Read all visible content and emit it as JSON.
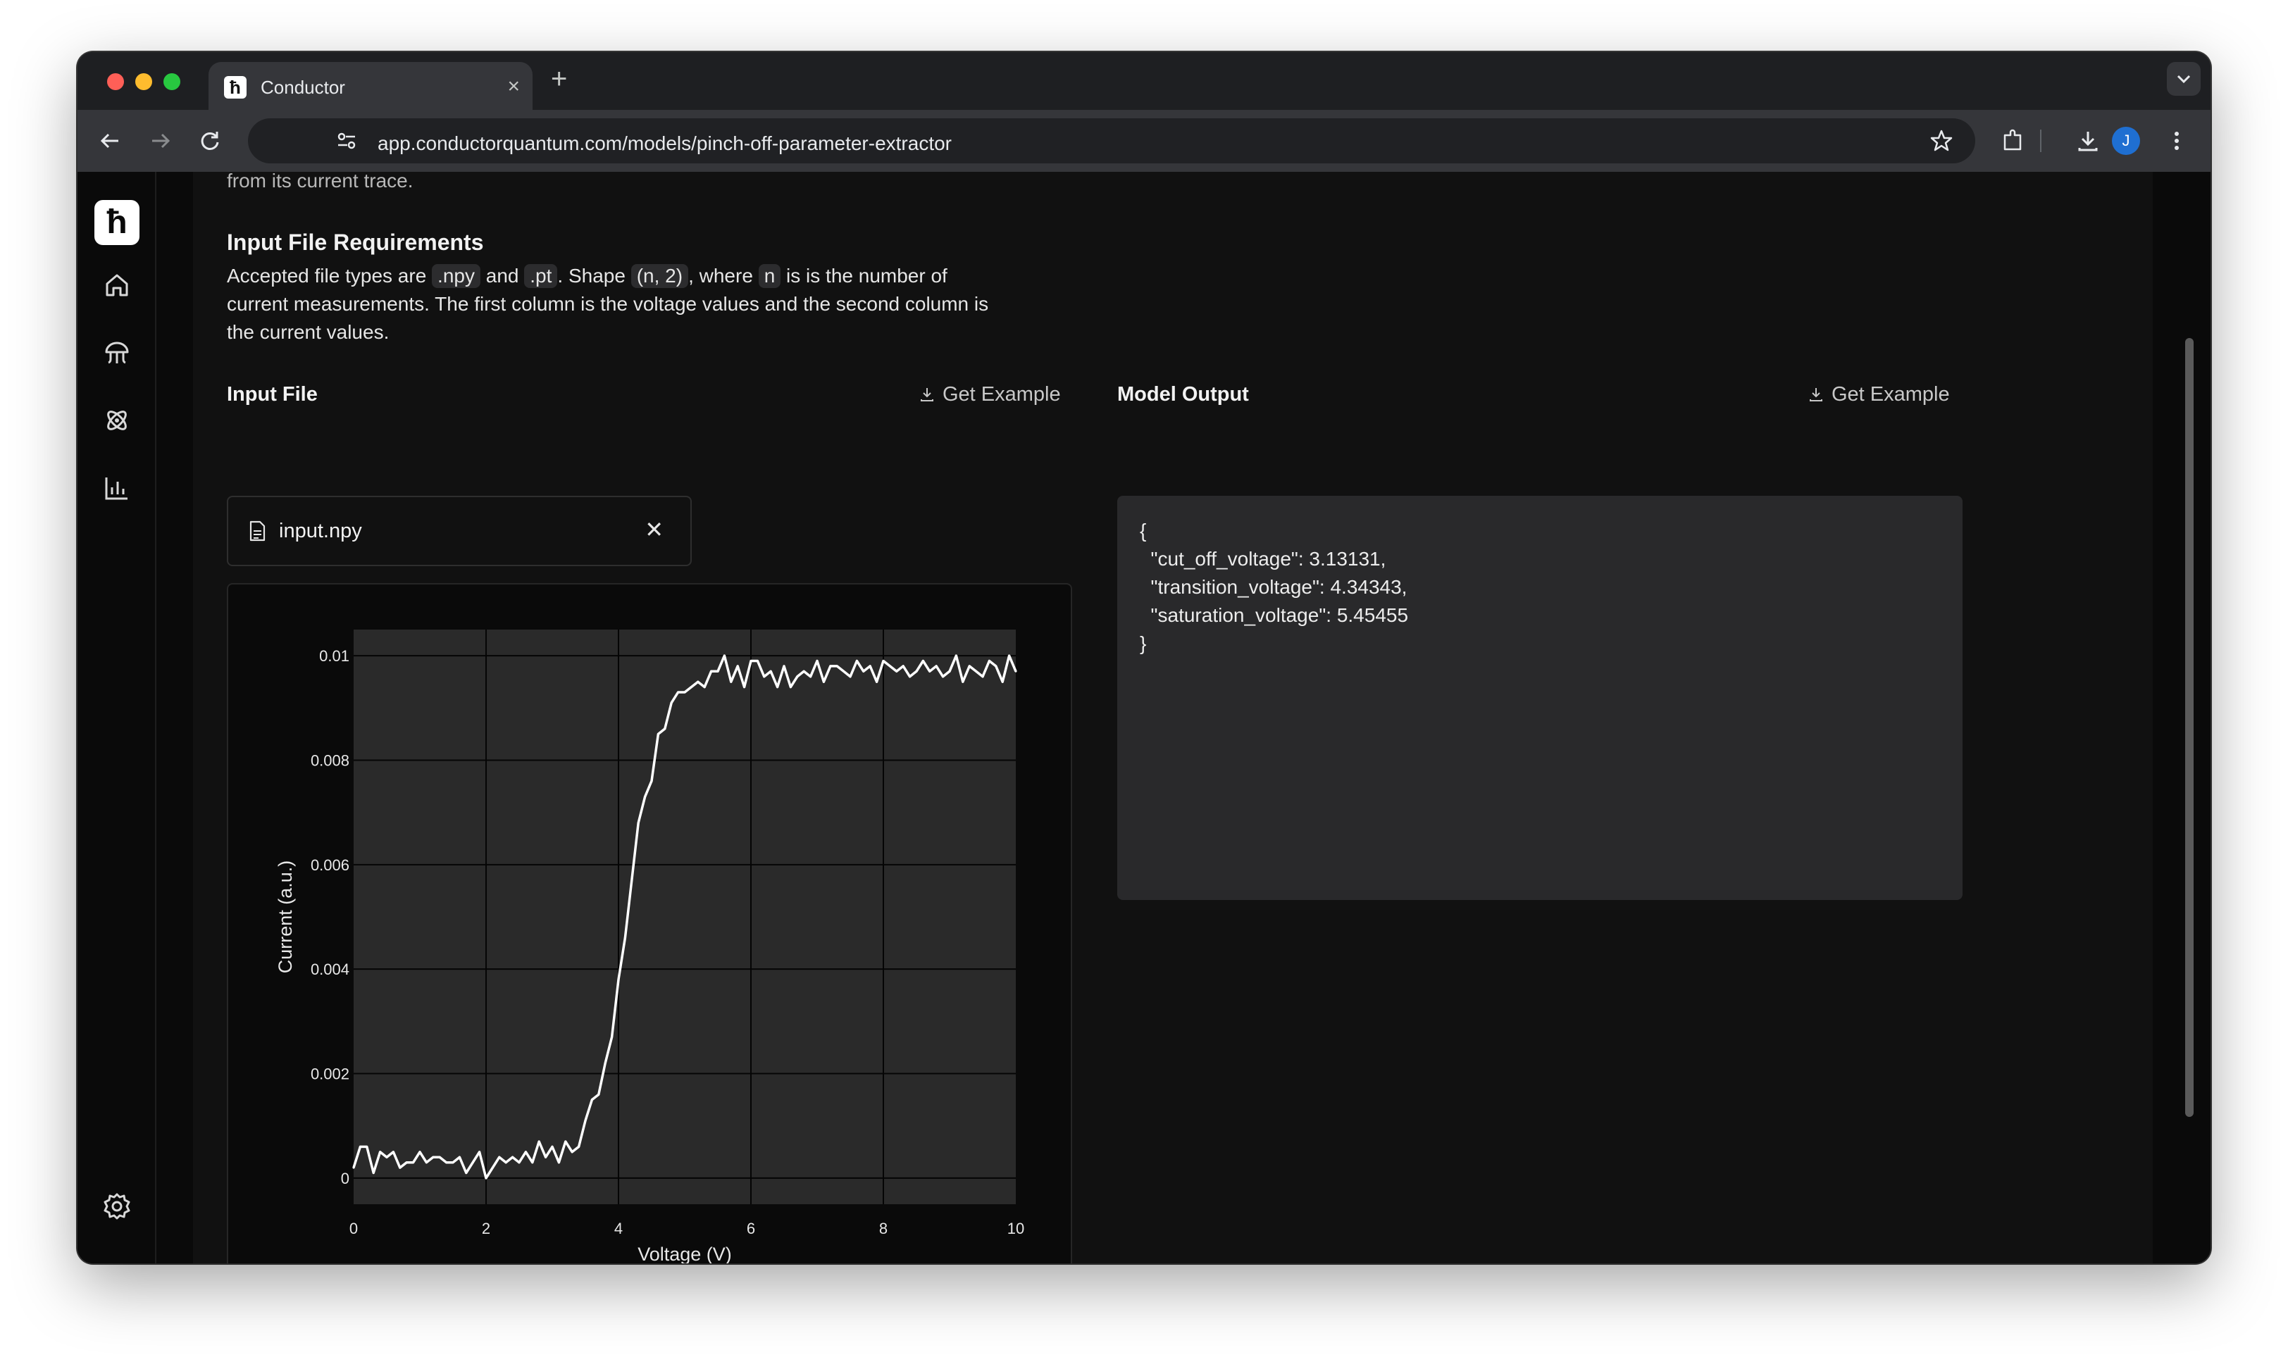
{
  "browser": {
    "tab_title": "Conductor",
    "tab_favicon": "conductor-logo",
    "new_tab": "+",
    "url": "app.conductorquantum.com/models/pinch-off-parameter-extractor",
    "avatar_initial": "J"
  },
  "sidebar": {
    "logo": "conductor-logo",
    "items": [
      "home-icon",
      "jellyfish-icon",
      "atom-icon",
      "bar-chart-icon"
    ],
    "settings": "gear-icon"
  },
  "content": {
    "cut_text": "from its current trace.",
    "req_heading": "Input File Requirements",
    "req": {
      "t1": "Accepted file types are ",
      "c1": ".npy",
      "t2": " and ",
      "c2": ".pt",
      "t3": ". Shape ",
      "c3": "(n, 2)",
      "t4": ", where ",
      "c4": "n",
      "t5": " is is the number of current measurements. The first column is the voltage values and the second column is the current values."
    },
    "input_label": "Input File",
    "get_example": "Get Example",
    "file_name": "input.npy",
    "file_remove": "✕",
    "output_label": "Model Output",
    "output_text": "{\n  \"cut_off_voltage\": 3.13131,\n  \"transition_voltage\": 4.34343,\n  \"saturation_voltage\": 5.45455\n}"
  },
  "colors": {
    "page_bg": "#111111",
    "panel_bg": "#29292b",
    "plot_bg": "#2a2a2a",
    "trace": "#ffffff"
  },
  "chart_data": {
    "type": "line",
    "xlabel": "Voltage (V)",
    "ylabel": "Current (a.u.)",
    "xlim": [
      0,
      10
    ],
    "ylim": [
      -0.0005,
      0.0105
    ],
    "x_ticks": [
      0,
      2,
      4,
      6,
      8,
      10
    ],
    "x_tick_labels": [
      "0",
      "2",
      "4",
      "6",
      "8",
      "10"
    ],
    "y_ticks": [
      0,
      0.002,
      0.004,
      0.006,
      0.008,
      0.01
    ],
    "y_tick_labels": [
      "0",
      "0.002",
      "0.004",
      "0.006",
      "0.008",
      "0.01"
    ],
    "grid": true,
    "series": [
      {
        "x": [
          0,
          0.1,
          0.2,
          0.3,
          0.4,
          0.5,
          0.6,
          0.7,
          0.8,
          0.9,
          1.0,
          1.1,
          1.2,
          1.3,
          1.4,
          1.5,
          1.6,
          1.7,
          1.8,
          1.9,
          2.0,
          2.1,
          2.2,
          2.3,
          2.4,
          2.5,
          2.6,
          2.7,
          2.8,
          2.9,
          3.0,
          3.1,
          3.2,
          3.3,
          3.4,
          3.5,
          3.6,
          3.7,
          3.8,
          3.9,
          4.0,
          4.1,
          4.2,
          4.3,
          4.4,
          4.5,
          4.6,
          4.7,
          4.8,
          4.9,
          5.0,
          5.1,
          5.2,
          5.3,
          5.4,
          5.5,
          5.6,
          5.7,
          5.8,
          5.9,
          6.0,
          6.1,
          6.2,
          6.3,
          6.4,
          6.5,
          6.6,
          6.7,
          6.8,
          6.9,
          7.0,
          7.1,
          7.2,
          7.3,
          7.4,
          7.5,
          7.6,
          7.7,
          7.8,
          7.9,
          8.0,
          8.1,
          8.2,
          8.3,
          8.4,
          8.5,
          8.6,
          8.7,
          8.8,
          8.9,
          9.0,
          9.1,
          9.2,
          9.3,
          9.4,
          9.5,
          9.6,
          9.7,
          9.8,
          9.9,
          10.0
        ],
        "y": [
          0.0002,
          0.0006,
          0.0006,
          0.0001,
          0.0005,
          0.0004,
          0.0005,
          0.0002,
          0.0003,
          0.0003,
          0.0005,
          0.0003,
          0.0004,
          0.0004,
          0.0003,
          0.0003,
          0.0004,
          0.0001,
          0.0003,
          0.0005,
          0.0,
          0.0002,
          0.0004,
          0.0003,
          0.0004,
          0.0003,
          0.0005,
          0.0003,
          0.0007,
          0.0004,
          0.0006,
          0.0003,
          0.0007,
          0.0005,
          0.0006,
          0.0011,
          0.0015,
          0.0016,
          0.0022,
          0.0027,
          0.0038,
          0.0046,
          0.0057,
          0.0068,
          0.0073,
          0.0076,
          0.0085,
          0.0086,
          0.0091,
          0.0093,
          0.0093,
          0.0094,
          0.0095,
          0.0094,
          0.0097,
          0.0097,
          0.01,
          0.0095,
          0.0098,
          0.0094,
          0.0099,
          0.0099,
          0.0096,
          0.0097,
          0.0094,
          0.0098,
          0.0094,
          0.0096,
          0.0097,
          0.0096,
          0.0099,
          0.0095,
          0.0098,
          0.0098,
          0.0097,
          0.0096,
          0.0099,
          0.0097,
          0.0098,
          0.0095,
          0.0099,
          0.0098,
          0.0097,
          0.0098,
          0.0096,
          0.0097,
          0.0099,
          0.0097,
          0.0098,
          0.0096,
          0.0097,
          0.01,
          0.0095,
          0.0098,
          0.0097,
          0.0096,
          0.0099,
          0.0098,
          0.0095,
          0.01,
          0.0097
        ]
      }
    ]
  }
}
